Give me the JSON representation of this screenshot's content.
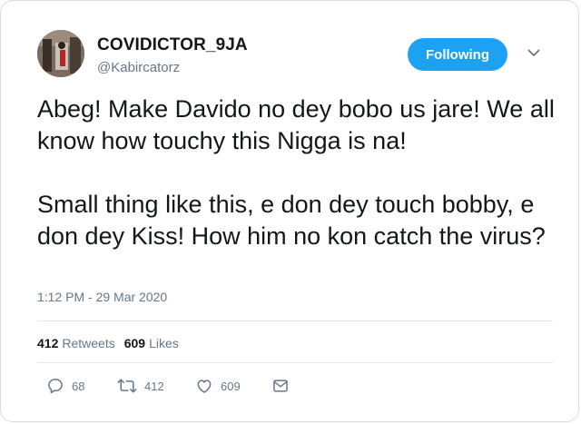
{
  "user": {
    "display_name": "COVIDICTOR_9JA",
    "handle": "@Kabircatorz"
  },
  "follow_button": {
    "label": "Following"
  },
  "tweet": {
    "paragraphs": [
      "Abeg! Make Davido no dey bobo us jare! We all know how touchy this Nigga is na!",
      "Small thing like this, e don dey touch bobby, e don dey Kiss! How him no kon catch the virus?"
    ],
    "timestamp": "1:12 PM - 29 Mar 2020"
  },
  "stats": {
    "retweets_count": "412",
    "retweets_label": "Retweets",
    "likes_count": "609",
    "likes_label": "Likes"
  },
  "actions": {
    "reply_count": "68",
    "retweet_count": "412",
    "like_count": "609"
  },
  "colors": {
    "accent": "#1da1f2",
    "secondary_text": "#657786",
    "primary_text": "#14171a"
  },
  "icons": [
    "chevron-down-icon",
    "reply-icon",
    "retweet-icon",
    "like-icon",
    "message-icon"
  ]
}
